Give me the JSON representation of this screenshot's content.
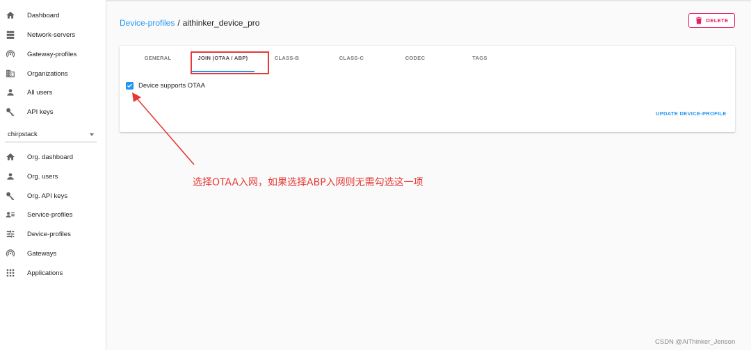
{
  "sidebar": {
    "global_items": [
      {
        "label": "Dashboard",
        "icon": "home-icon"
      },
      {
        "label": "Network-servers",
        "icon": "server-icon"
      },
      {
        "label": "Gateway-profiles",
        "icon": "wifi-tethering-icon"
      },
      {
        "label": "Organizations",
        "icon": "domain-icon"
      },
      {
        "label": "All users",
        "icon": "person-icon"
      },
      {
        "label": "API keys",
        "icon": "key-icon"
      }
    ],
    "organization_select": {
      "value": "chirpstack"
    },
    "org_items": [
      {
        "label": "Org. dashboard",
        "icon": "home-icon"
      },
      {
        "label": "Org. users",
        "icon": "person-icon"
      },
      {
        "label": "Org. API keys",
        "icon": "key-icon"
      },
      {
        "label": "Service-profiles",
        "icon": "account-details-icon"
      },
      {
        "label": "Device-profiles",
        "icon": "tune-icon"
      },
      {
        "label": "Gateways",
        "icon": "wifi-tethering-icon"
      },
      {
        "label": "Applications",
        "icon": "apps-icon"
      }
    ]
  },
  "header": {
    "breadcrumb_link": "Device-profiles",
    "breadcrumb_separator": "/",
    "breadcrumb_current": "aithinker_device_pro",
    "delete_label": "DELETE"
  },
  "card": {
    "tabs": [
      {
        "label": "GENERAL"
      },
      {
        "label": "JOIN (OTAA / ABP)"
      },
      {
        "label": "CLASS-B"
      },
      {
        "label": "CLASS-C"
      },
      {
        "label": "CODEC"
      },
      {
        "label": "TAGS"
      }
    ],
    "active_tab": "JOIN (OTAA / ABP)",
    "otaa_checkbox": {
      "label": "Device supports OTAA",
      "checked": true
    },
    "update_label": "UPDATE DEVICE-PROFILE"
  },
  "annotation": {
    "text": "选择OTAA入网，如果选择ABP入网则无需勾选这一项",
    "color": "#e53935"
  },
  "watermark": "CSDN @AiThinker_Jenson",
  "colors": {
    "accent": "#2196f3",
    "danger": "#e91e63",
    "annotation": "#e53935"
  }
}
